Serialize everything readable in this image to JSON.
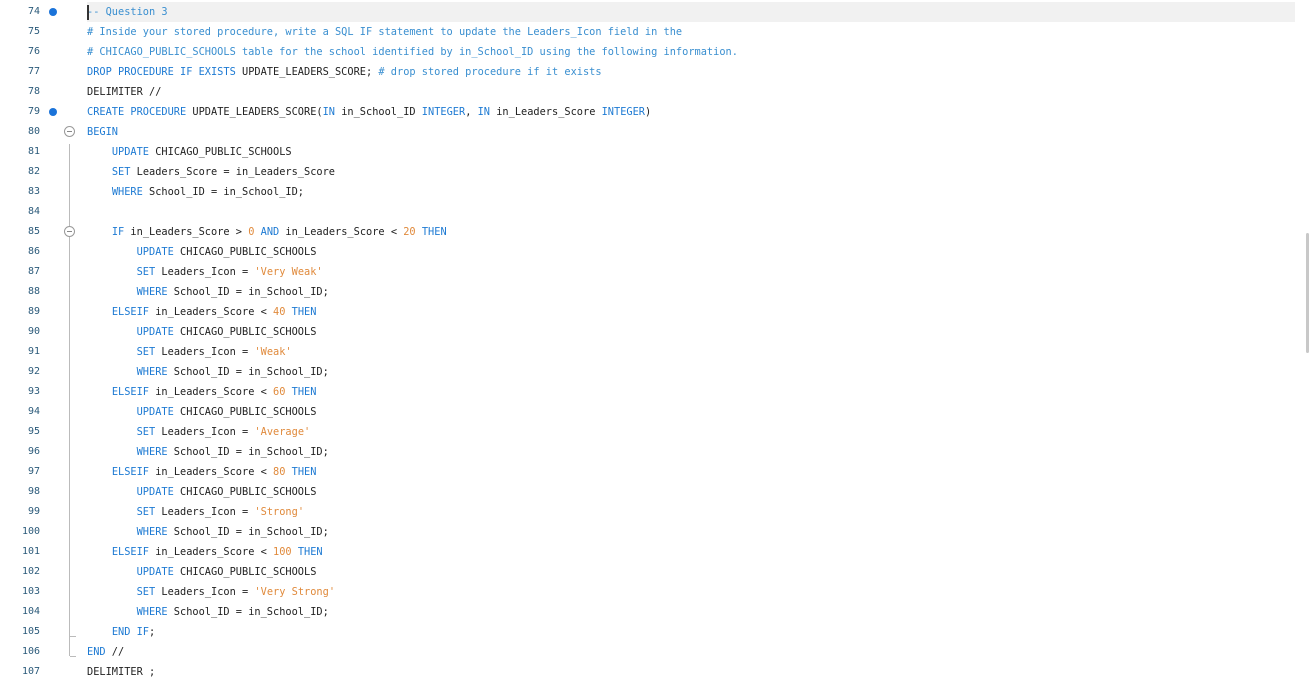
{
  "editor": {
    "current_line": 74,
    "breakpoints": [
      74,
      79
    ],
    "fold_markers": [
      80,
      85
    ],
    "lines": [
      {
        "n": 74,
        "indent": 0,
        "tokens": [
          [
            "cm",
            "-- Question 3"
          ]
        ]
      },
      {
        "n": 75,
        "indent": 0,
        "tokens": [
          [
            "cm",
            "# Inside your stored procedure, write a SQL IF statement to update the Leaders_Icon field in the"
          ]
        ]
      },
      {
        "n": 76,
        "indent": 0,
        "tokens": [
          [
            "cm",
            "# CHICAGO_PUBLIC_SCHOOLS table for the school identified by in_School_ID using the following information."
          ]
        ]
      },
      {
        "n": 77,
        "indent": 0,
        "tokens": [
          [
            "kw",
            "DROP PROCEDURE IF EXISTS"
          ],
          [
            "tx",
            " UPDATE_LEADERS_SCORE; "
          ],
          [
            "cm",
            "# drop stored procedure if it exists"
          ]
        ]
      },
      {
        "n": 78,
        "indent": 0,
        "tokens": [
          [
            "tx",
            "DELIMITER //"
          ]
        ]
      },
      {
        "n": 79,
        "indent": 0,
        "tokens": [
          [
            "kw",
            "CREATE PROCEDURE"
          ],
          [
            "tx",
            " UPDATE_LEADERS_SCORE("
          ],
          [
            "kw",
            "IN"
          ],
          [
            "tx",
            " in_School_ID "
          ],
          [
            "kw",
            "INTEGER"
          ],
          [
            "tx",
            ", "
          ],
          [
            "kw",
            "IN"
          ],
          [
            "tx",
            " in_Leaders_Score "
          ],
          [
            "kw",
            "INTEGER"
          ],
          [
            "tx",
            ")"
          ]
        ]
      },
      {
        "n": 80,
        "indent": 0,
        "tokens": [
          [
            "kw",
            "BEGIN"
          ]
        ]
      },
      {
        "n": 81,
        "indent": 1,
        "tokens": [
          [
            "kw",
            "UPDATE"
          ],
          [
            "tx",
            " CHICAGO_PUBLIC_SCHOOLS"
          ]
        ]
      },
      {
        "n": 82,
        "indent": 1,
        "tokens": [
          [
            "kw",
            "SET"
          ],
          [
            "tx",
            " Leaders_Score = in_Leaders_Score"
          ]
        ]
      },
      {
        "n": 83,
        "indent": 1,
        "tokens": [
          [
            "kw",
            "WHERE"
          ],
          [
            "tx",
            " School_ID = in_School_ID;"
          ]
        ]
      },
      {
        "n": 84,
        "indent": 0,
        "tokens": []
      },
      {
        "n": 85,
        "indent": 1,
        "tokens": [
          [
            "kw",
            "IF"
          ],
          [
            "tx",
            " in_Leaders_Score > "
          ],
          [
            "num",
            "0"
          ],
          [
            "tx",
            " "
          ],
          [
            "kw",
            "AND"
          ],
          [
            "tx",
            " in_Leaders_Score < "
          ],
          [
            "num",
            "20"
          ],
          [
            "tx",
            " "
          ],
          [
            "kw",
            "THEN"
          ]
        ]
      },
      {
        "n": 86,
        "indent": 2,
        "tokens": [
          [
            "kw",
            "UPDATE"
          ],
          [
            "tx",
            " CHICAGO_PUBLIC_SCHOOLS"
          ]
        ]
      },
      {
        "n": 87,
        "indent": 2,
        "tokens": [
          [
            "kw",
            "SET"
          ],
          [
            "tx",
            " Leaders_Icon = "
          ],
          [
            "str",
            "'Very Weak'"
          ]
        ]
      },
      {
        "n": 88,
        "indent": 2,
        "tokens": [
          [
            "kw",
            "WHERE"
          ],
          [
            "tx",
            " School_ID = in_School_ID;"
          ]
        ]
      },
      {
        "n": 89,
        "indent": 1,
        "tokens": [
          [
            "kw",
            "ELSEIF"
          ],
          [
            "tx",
            " in_Leaders_Score < "
          ],
          [
            "num",
            "40"
          ],
          [
            "tx",
            " "
          ],
          [
            "kw",
            "THEN"
          ]
        ]
      },
      {
        "n": 90,
        "indent": 2,
        "tokens": [
          [
            "kw",
            "UPDATE"
          ],
          [
            "tx",
            " CHICAGO_PUBLIC_SCHOOLS"
          ]
        ]
      },
      {
        "n": 91,
        "indent": 2,
        "tokens": [
          [
            "kw",
            "SET"
          ],
          [
            "tx",
            " Leaders_Icon = "
          ],
          [
            "str",
            "'Weak'"
          ]
        ]
      },
      {
        "n": 92,
        "indent": 2,
        "tokens": [
          [
            "kw",
            "WHERE"
          ],
          [
            "tx",
            " School_ID = in_School_ID;"
          ]
        ]
      },
      {
        "n": 93,
        "indent": 1,
        "tokens": [
          [
            "kw",
            "ELSEIF"
          ],
          [
            "tx",
            " in_Leaders_Score < "
          ],
          [
            "num",
            "60"
          ],
          [
            "tx",
            " "
          ],
          [
            "kw",
            "THEN"
          ]
        ]
      },
      {
        "n": 94,
        "indent": 2,
        "tokens": [
          [
            "kw",
            "UPDATE"
          ],
          [
            "tx",
            " CHICAGO_PUBLIC_SCHOOLS"
          ]
        ]
      },
      {
        "n": 95,
        "indent": 2,
        "tokens": [
          [
            "kw",
            "SET"
          ],
          [
            "tx",
            " Leaders_Icon = "
          ],
          [
            "str",
            "'Average'"
          ]
        ]
      },
      {
        "n": 96,
        "indent": 2,
        "tokens": [
          [
            "kw",
            "WHERE"
          ],
          [
            "tx",
            " School_ID = in_School_ID;"
          ]
        ]
      },
      {
        "n": 97,
        "indent": 1,
        "tokens": [
          [
            "kw",
            "ELSEIF"
          ],
          [
            "tx",
            " in_Leaders_Score < "
          ],
          [
            "num",
            "80"
          ],
          [
            "tx",
            " "
          ],
          [
            "kw",
            "THEN"
          ]
        ]
      },
      {
        "n": 98,
        "indent": 2,
        "tokens": [
          [
            "kw",
            "UPDATE"
          ],
          [
            "tx",
            " CHICAGO_PUBLIC_SCHOOLS"
          ]
        ]
      },
      {
        "n": 99,
        "indent": 2,
        "tokens": [
          [
            "kw",
            "SET"
          ],
          [
            "tx",
            " Leaders_Icon = "
          ],
          [
            "str",
            "'Strong'"
          ]
        ]
      },
      {
        "n": 100,
        "indent": 2,
        "tokens": [
          [
            "kw",
            "WHERE"
          ],
          [
            "tx",
            " School_ID = in_School_ID;"
          ]
        ]
      },
      {
        "n": 101,
        "indent": 1,
        "tokens": [
          [
            "kw",
            "ELSEIF"
          ],
          [
            "tx",
            " in_Leaders_Score < "
          ],
          [
            "num",
            "100"
          ],
          [
            "tx",
            " "
          ],
          [
            "kw",
            "THEN"
          ]
        ]
      },
      {
        "n": 102,
        "indent": 2,
        "tokens": [
          [
            "kw",
            "UPDATE"
          ],
          [
            "tx",
            " CHICAGO_PUBLIC_SCHOOLS"
          ]
        ]
      },
      {
        "n": 103,
        "indent": 2,
        "tokens": [
          [
            "kw",
            "SET"
          ],
          [
            "tx",
            " Leaders_Icon = "
          ],
          [
            "str",
            "'Very Strong'"
          ]
        ]
      },
      {
        "n": 104,
        "indent": 2,
        "tokens": [
          [
            "kw",
            "WHERE"
          ],
          [
            "tx",
            " School_ID = in_School_ID;"
          ]
        ]
      },
      {
        "n": 105,
        "indent": 1,
        "tokens": [
          [
            "kw",
            "END IF"
          ],
          [
            "tx",
            ";"
          ]
        ]
      },
      {
        "n": 106,
        "indent": 0,
        "tokens": [
          [
            "kw",
            "END"
          ],
          [
            "tx",
            " //"
          ]
        ]
      },
      {
        "n": 107,
        "indent": 0,
        "tokens": [
          [
            "tx",
            "DELIMITER ;"
          ]
        ]
      }
    ]
  }
}
